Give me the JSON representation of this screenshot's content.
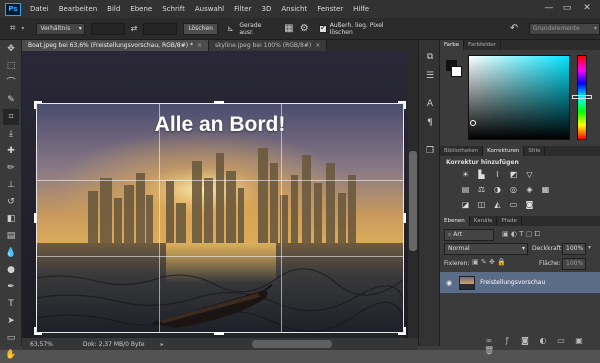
{
  "app": {
    "logo": "Ps"
  },
  "menu": [
    "Datei",
    "Bearbeiten",
    "Bild",
    "Ebene",
    "Schrift",
    "Auswahl",
    "Filter",
    "3D",
    "Ansicht",
    "Fenster",
    "Hilfe"
  ],
  "window_controls": {
    "minimize": "—",
    "maximize": "▭",
    "close": "✕"
  },
  "options": {
    "ratio": "Verhältnis",
    "clear": "Löschen",
    "straighten": "Gerade ausr.",
    "delete_pixels": "Außerh. lieg. Pixel löschen",
    "workspace": "Grundelemente"
  },
  "tabs": [
    {
      "label": "Boat.jpeg bei 63,6% (Freistellungsvorschau, RGB/8#) *",
      "close": "×"
    },
    {
      "label": "skyline.jpeg bei 100% (RGB/8#)",
      "close": "×"
    }
  ],
  "canvas": {
    "headline": "Alle an Bord!"
  },
  "status": {
    "zoom": "63,57%",
    "doc": "Dok: 2,37 MB/0 Byte"
  },
  "color_panel": {
    "tabs": [
      "Farbe",
      "Farbfelder"
    ]
  },
  "adjust_panel": {
    "tabs": [
      "Bibliotheken",
      "Korrekturen",
      "Stile"
    ],
    "title": "Korrektur hinzufügen"
  },
  "layers_panel": {
    "tabs": [
      "Ebenen",
      "Kanäle",
      "Pfade"
    ],
    "search": "Art",
    "blend": "Normal",
    "opacity_label": "Deckkraft:",
    "opacity_value": "100%",
    "lock_label": "Fixieren:",
    "fill_label": "Fläche:",
    "fill_value": "100%",
    "layer_name": "Freistellungsvorschau"
  },
  "colors": {
    "accent": "#31a8ff",
    "layer_selected": "#5a6c86"
  }
}
